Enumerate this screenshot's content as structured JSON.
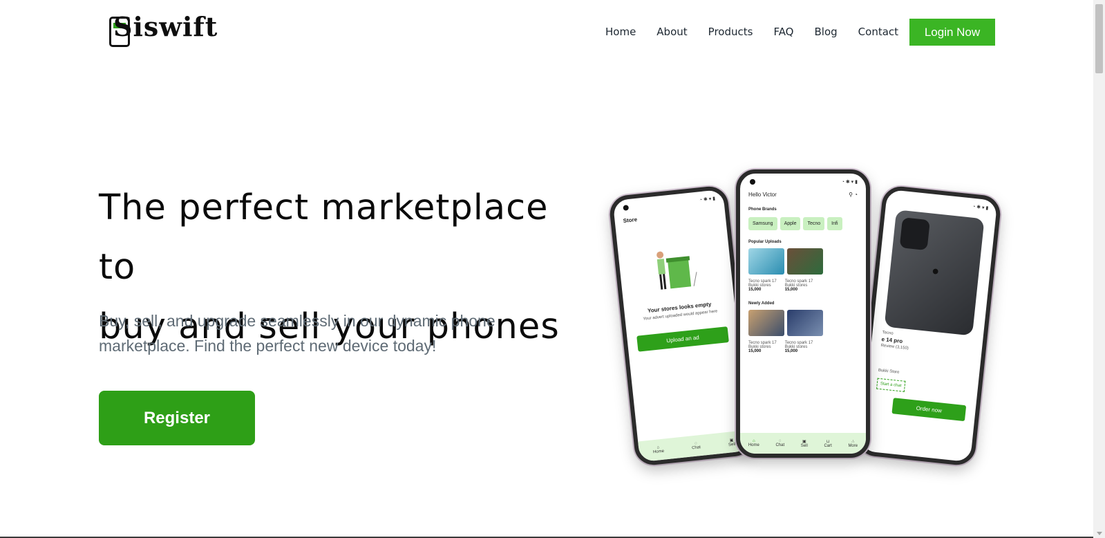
{
  "brand": {
    "name": "Siswift",
    "accent": "#2ea01a"
  },
  "nav": {
    "items": [
      "Home",
      "About",
      "Products",
      "FAQ",
      "Blog",
      "Contact"
    ],
    "login_label": "Login Now"
  },
  "hero": {
    "headline_line1": "The perfect marketplace to",
    "headline_line2": "buy and sell your phones",
    "subtext_line1": "Buy, sell, and upgrade seamlessly in our dynamic phone",
    "subtext_line2": "marketplace. Find the perfect new device today!",
    "register_label": "Register"
  },
  "phones": {
    "left": {
      "title": "Store",
      "empty_title": "Your stores looks empty",
      "empty_sub": "Your advert uploaded would appear here",
      "button": "Upload an ad",
      "tabs": [
        "Home",
        "Chat",
        "Sell"
      ]
    },
    "center": {
      "greeting": "Hello Victor",
      "brands_title": "Phone Brands",
      "brands": [
        "Samsung",
        "Apple",
        "Tecno",
        "Infi"
      ],
      "popular_title": "Popular Uploads",
      "newly_title": "Newly Added",
      "item_name": "Tecno spark 17",
      "item_store": "Bukki stores",
      "item_price": "15,000",
      "tabs": [
        "Home",
        "Chat",
        "Sell",
        "Cart",
        "More"
      ]
    },
    "right": {
      "brand": "Tecno",
      "model": "e 14 pro",
      "review": "Review (3,150)",
      "store": "Bukki Store",
      "chat": "Start a chat",
      "order": "Order now"
    }
  }
}
